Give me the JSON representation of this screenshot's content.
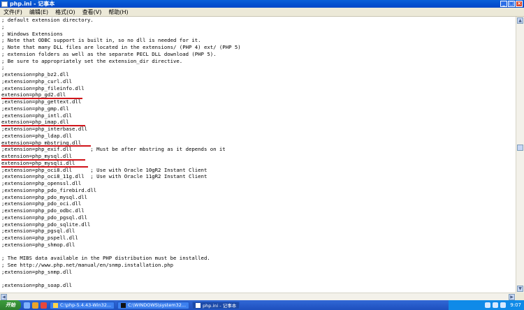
{
  "window": {
    "title": "php.ini - 记事本",
    "min": "_",
    "max": "□",
    "close": "×"
  },
  "menu": [
    "文件(F)",
    "编辑(E)",
    "格式(O)",
    "查看(V)",
    "帮助(H)"
  ],
  "lines": [
    "; default extension directory.",
    ";",
    "; Windows Extensions",
    "; Note that ODBC support is built in, so no dll is needed for it.",
    "; Note that many DLL files are located in the extensions/ (PHP 4) ext/ (PHP 5)",
    "; extension folders as well as the separate PECL DLL download (PHP 5).",
    "; Be sure to appropriately set the extension_dir directive.",
    ";",
    ";extension=php_bz2.dll",
    ";extension=php_curl.dll",
    ";extension=php_fileinfo.dll",
    "extension=php_gd2.dll",
    ";extension=php_gettext.dll",
    ";extension=php_gmp.dll",
    ";extension=php_intl.dll",
    "extension=php_imap.dll",
    ";extension=php_interbase.dll",
    ";extension=php_ldap.dll",
    "extension=php_mbstring.dll",
    ";extension=php_exif.dll      ; Must be after mbstring as it depends on it",
    "extension=php_mysql.dll",
    "extension=php_mysqli.dll",
    ";extension=php_oci8.dll      ; Use with Oracle 10gR2 Instant Client",
    ";extension=php_oci8_11g.dll  ; Use with Oracle 11gR2 Instant Client",
    ";extension=php_openssl.dll",
    ";extension=php_pdo_firebird.dll",
    ";extension=php_pdo_mysql.dll",
    ";extension=php_pdo_oci.dll",
    ";extension=php_pdo_odbc.dll",
    ";extension=php_pdo_pgsql.dll",
    ";extension=php_pdo_sqlite.dll",
    ";extension=php_pgsql.dll",
    ";extension=php_pspell.dll",
    ";extension=php_shmop.dll",
    "",
    "; The MIBS data available in the PHP distribution must be installed.",
    "; See http://www.php.net/manual/en/snmp.installation.php",
    ";extension=php_snmp.dll",
    "",
    ";extension=php_soap.dll"
  ],
  "taskbar": {
    "start": "开始",
    "tasks": [
      "C:\\php-5.4.43-Win32...",
      "C:\\WINDOWS\\system32...",
      "php.ini - 记事本"
    ],
    "clock": "9:07"
  }
}
